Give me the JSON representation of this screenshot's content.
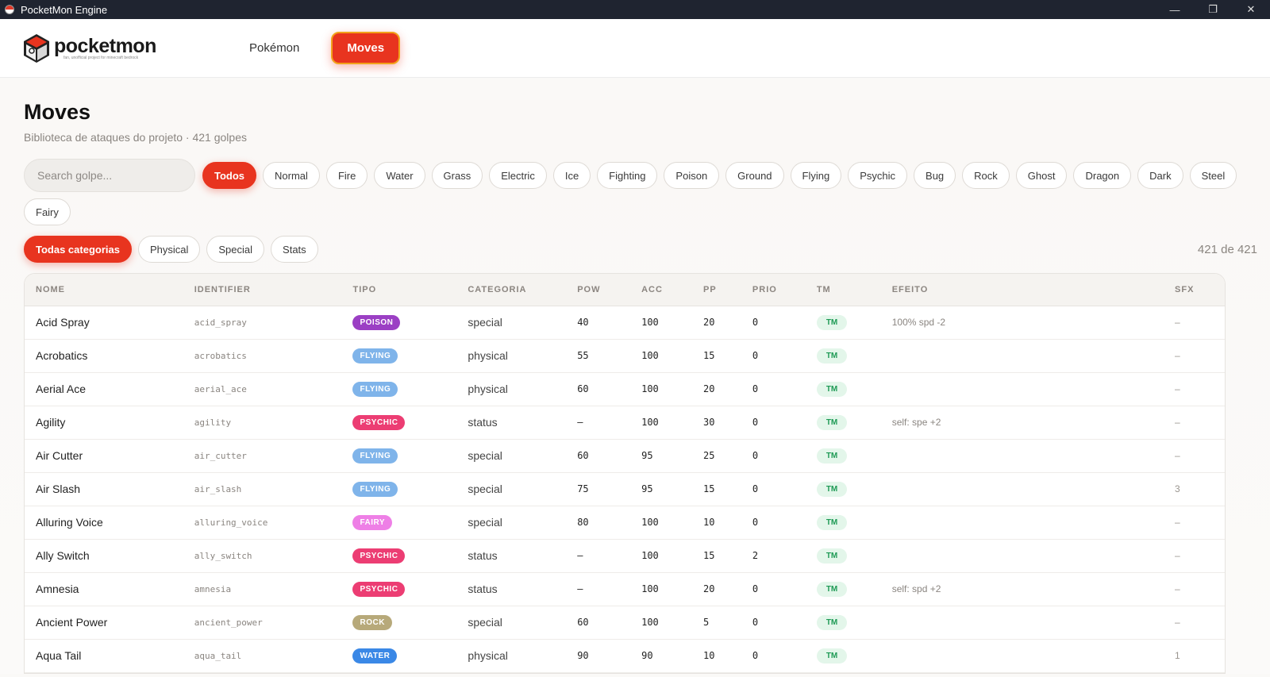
{
  "window": {
    "title": "PocketMon Engine",
    "controls": [
      "—",
      "❐",
      "✕"
    ]
  },
  "header": {
    "logo_name": "pocketmon",
    "logo_sub": "fan, unofficial project for minecraft bedrock",
    "nav": [
      {
        "label": "Pokémon",
        "active": false
      },
      {
        "label": "Moves",
        "active": true
      }
    ]
  },
  "page": {
    "title": "Moves",
    "subtitle": "Biblioteca de ataques do projeto · 421 golpes"
  },
  "search": {
    "placeholder": "Search golpe..."
  },
  "type_filters": [
    "Todos",
    "Normal",
    "Fire",
    "Water",
    "Grass",
    "Electric",
    "Ice",
    "Fighting",
    "Poison",
    "Ground",
    "Flying",
    "Psychic",
    "Bug",
    "Rock",
    "Ghost",
    "Dragon",
    "Dark",
    "Steel",
    "Fairy"
  ],
  "active_type": "Todos",
  "category_filters": [
    "Todas categorias",
    "Physical",
    "Special",
    "Stats"
  ],
  "active_category": "Todas categorias",
  "result_count": "421 de 421",
  "type_colors": {
    "POISON": "#9b3fc4",
    "FLYING": "#7fb4ea",
    "PSYCHIC": "#ec3d73",
    "FAIRY": "#ee7fe6",
    "ROCK": "#b7a97a",
    "WATER": "#3a88e6"
  },
  "table": {
    "columns": [
      "NOME",
      "IDENTIFIER",
      "TIPO",
      "CATEGORIA",
      "POW",
      "ACC",
      "PP",
      "PRIO",
      "TM",
      "EFEITO",
      "SFX"
    ],
    "rows": [
      {
        "name": "Acid Spray",
        "id": "acid_spray",
        "type": "POISON",
        "category": "special",
        "pow": "40",
        "acc": "100",
        "pp": "20",
        "prio": "0",
        "tm": "TM",
        "effect": "100% spd -2",
        "sfx": "–"
      },
      {
        "name": "Acrobatics",
        "id": "acrobatics",
        "type": "FLYING",
        "category": "physical",
        "pow": "55",
        "acc": "100",
        "pp": "15",
        "prio": "0",
        "tm": "TM",
        "effect": "",
        "sfx": "–"
      },
      {
        "name": "Aerial Ace",
        "id": "aerial_ace",
        "type": "FLYING",
        "category": "physical",
        "pow": "60",
        "acc": "100",
        "pp": "20",
        "prio": "0",
        "tm": "TM",
        "effect": "",
        "sfx": "–"
      },
      {
        "name": "Agility",
        "id": "agility",
        "type": "PSYCHIC",
        "category": "status",
        "pow": "–",
        "acc": "100",
        "pp": "30",
        "prio": "0",
        "tm": "TM",
        "effect": "self: spe +2",
        "sfx": "–"
      },
      {
        "name": "Air Cutter",
        "id": "air_cutter",
        "type": "FLYING",
        "category": "special",
        "pow": "60",
        "acc": "95",
        "pp": "25",
        "prio": "0",
        "tm": "TM",
        "effect": "",
        "sfx": "–"
      },
      {
        "name": "Air Slash",
        "id": "air_slash",
        "type": "FLYING",
        "category": "special",
        "pow": "75",
        "acc": "95",
        "pp": "15",
        "prio": "0",
        "tm": "TM",
        "effect": "",
        "sfx": "3"
      },
      {
        "name": "Alluring Voice",
        "id": "alluring_voice",
        "type": "FAIRY",
        "category": "special",
        "pow": "80",
        "acc": "100",
        "pp": "10",
        "prio": "0",
        "tm": "TM",
        "effect": "",
        "sfx": "–"
      },
      {
        "name": "Ally Switch",
        "id": "ally_switch",
        "type": "PSYCHIC",
        "category": "status",
        "pow": "–",
        "acc": "100",
        "pp": "15",
        "prio": "2",
        "tm": "TM",
        "effect": "",
        "sfx": "–"
      },
      {
        "name": "Amnesia",
        "id": "amnesia",
        "type": "PSYCHIC",
        "category": "status",
        "pow": "–",
        "acc": "100",
        "pp": "20",
        "prio": "0",
        "tm": "TM",
        "effect": "self: spd +2",
        "sfx": "–"
      },
      {
        "name": "Ancient Power",
        "id": "ancient_power",
        "type": "ROCK",
        "category": "special",
        "pow": "60",
        "acc": "100",
        "pp": "5",
        "prio": "0",
        "tm": "TM",
        "effect": "",
        "sfx": "–"
      },
      {
        "name": "Aqua Tail",
        "id": "aqua_tail",
        "type": "WATER",
        "category": "physical",
        "pow": "90",
        "acc": "90",
        "pp": "10",
        "prio": "0",
        "tm": "TM",
        "effect": "",
        "sfx": "1"
      }
    ]
  }
}
